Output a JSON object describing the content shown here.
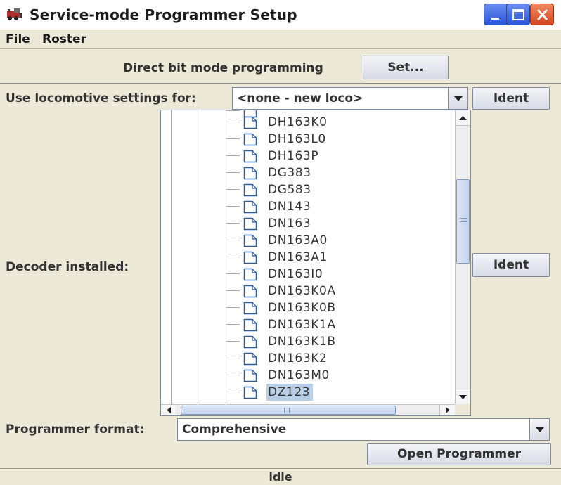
{
  "window": {
    "title": "Service-mode Programmer Setup",
    "title_icon": "train-icon",
    "controls": [
      "minimize-icon",
      "maximize-icon",
      "close-icon"
    ]
  },
  "menu": {
    "file": "File",
    "roster": "Roster"
  },
  "direct_bit": {
    "label": "Direct bit mode programming",
    "button": "Set..."
  },
  "loco": {
    "label": "Use locomotive settings for:",
    "value": "<none - new loco>",
    "ident": "Ident"
  },
  "decoder": {
    "label": "Decoder installed:",
    "ident": "Ident",
    "items": [
      {
        "name": "DH163K0"
      },
      {
        "name": "DH163L0"
      },
      {
        "name": "DH163P"
      },
      {
        "name": "DG383"
      },
      {
        "name": "DG583"
      },
      {
        "name": "DN143"
      },
      {
        "name": "DN163"
      },
      {
        "name": "DN163A0"
      },
      {
        "name": "DN163A1"
      },
      {
        "name": "DN163I0"
      },
      {
        "name": "DN163K0A"
      },
      {
        "name": "DN163K0B"
      },
      {
        "name": "DN163K1A"
      },
      {
        "name": "DN163K1B"
      },
      {
        "name": "DN163K2"
      },
      {
        "name": "DN163M0"
      },
      {
        "name": "DZ123",
        "selected": true
      }
    ]
  },
  "format": {
    "label": "Programmer format:",
    "value": "Comprehensive"
  },
  "open_button": "Open Programmer",
  "status": "idle",
  "colors": {
    "selection": "#b8cfe5",
    "scroll_thumb": "#c2d4ee",
    "close_button": "#d24420",
    "window_bg": "#ece9d8"
  }
}
